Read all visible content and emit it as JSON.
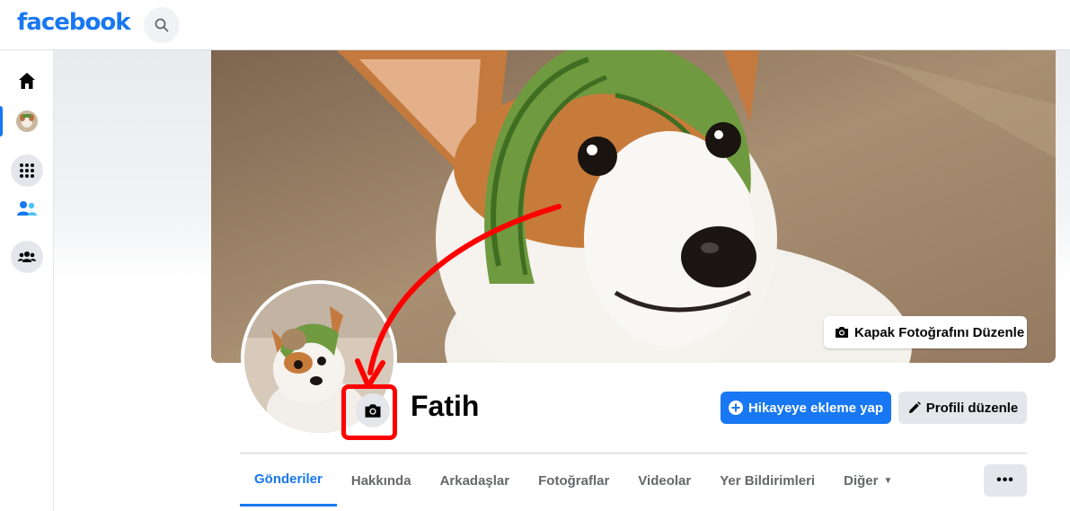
{
  "header": {
    "logo": "facebook",
    "search_icon": "search-icon"
  },
  "nav": {
    "items": [
      {
        "name": "home",
        "icon": "home-icon"
      },
      {
        "name": "profile",
        "icon": "avatar-icon",
        "active": true
      },
      {
        "name": "menu",
        "icon": "grid-icon"
      },
      {
        "name": "friends",
        "icon": "friends-icon"
      },
      {
        "name": "groups",
        "icon": "groups-icon"
      }
    ]
  },
  "profile": {
    "name": "Fatih",
    "edit_cover_label": "Kapak Fotoğrafını Düzenle",
    "add_story_label": "Hikayeye ekleme yap",
    "edit_profile_label": "Profili düzenle"
  },
  "tabs": [
    {
      "label": "Gönderiler",
      "active": true
    },
    {
      "label": "Hakkında"
    },
    {
      "label": "Arkadaşlar"
    },
    {
      "label": "Fotoğraflar"
    },
    {
      "label": "Videolar"
    },
    {
      "label": "Yer Bildirimleri"
    },
    {
      "label": "Diğer"
    }
  ],
  "more_label": "•••",
  "colors": {
    "brand": "#1877f2",
    "annotation": "#ff0000"
  }
}
